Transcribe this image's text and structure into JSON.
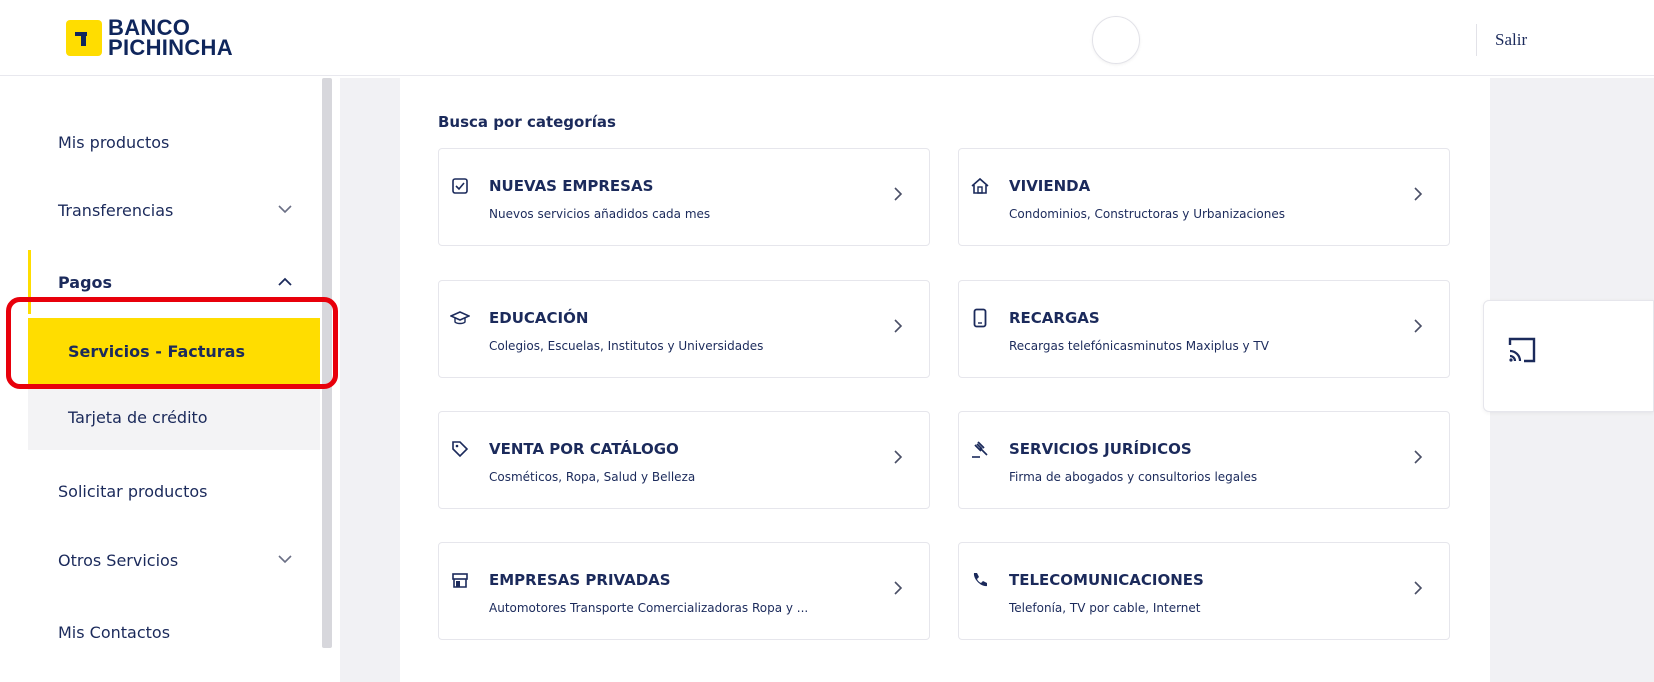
{
  "header": {
    "brand_line1": "BANCO",
    "brand_line2": "PICHINCHA",
    "logout_label": "Salir"
  },
  "sidebar": {
    "items": [
      {
        "label": "Mis productos"
      },
      {
        "label": "Transferencias",
        "chevron": "chevron-down-icon"
      },
      {
        "label": "Pagos",
        "chevron": "chevron-up-icon",
        "active": true
      },
      {
        "label": "Servicios - Facturas",
        "selected": true
      },
      {
        "label": "Tarjeta de crédito"
      },
      {
        "label": "Solicitar productos"
      },
      {
        "label": "Otros Servicios",
        "chevron": "chevron-down-icon"
      },
      {
        "label": "Mis Contactos"
      }
    ]
  },
  "main": {
    "section_title": "Busca por categorías",
    "categories": [
      {
        "icon": "checklist-icon",
        "title": "NUEVAS EMPRESAS",
        "subtitle": "Nuevos servicios añadidos cada mes"
      },
      {
        "icon": "house-icon",
        "title": "VIVIENDA",
        "subtitle": "Condominios, Constructoras y Urbanizaciones"
      },
      {
        "icon": "graduation-cap-icon",
        "title": "EDUCACIÓN",
        "subtitle": "Colegios, Escuelas, Institutos y Universidades"
      },
      {
        "icon": "phone-icon",
        "title": "RECARGAS",
        "subtitle": "Recargas telefónicasminutos Maxiplus y TV"
      },
      {
        "icon": "tag-icon",
        "title": "VENTA POR CATÁLOGO",
        "subtitle": "Cosméticos, Ropa, Salud y Belleza"
      },
      {
        "icon": "gavel-icon",
        "title": "SERVICIOS JURÍDICOS",
        "subtitle": "Firma de abogados y consultorios legales"
      },
      {
        "icon": "store-icon",
        "title": "EMPRESAS PRIVADAS",
        "subtitle": "Automotores Transporte Comercializadoras Ropa y ..."
      },
      {
        "icon": "telephone-icon",
        "title": "TELECOMUNICACIONES",
        "subtitle": "Telefonía, TV por cable, Internet"
      }
    ]
  },
  "colors": {
    "brand_yellow": "#ffdd00",
    "brand_navy": "#0f265c",
    "highlight_red": "#e8000b"
  }
}
